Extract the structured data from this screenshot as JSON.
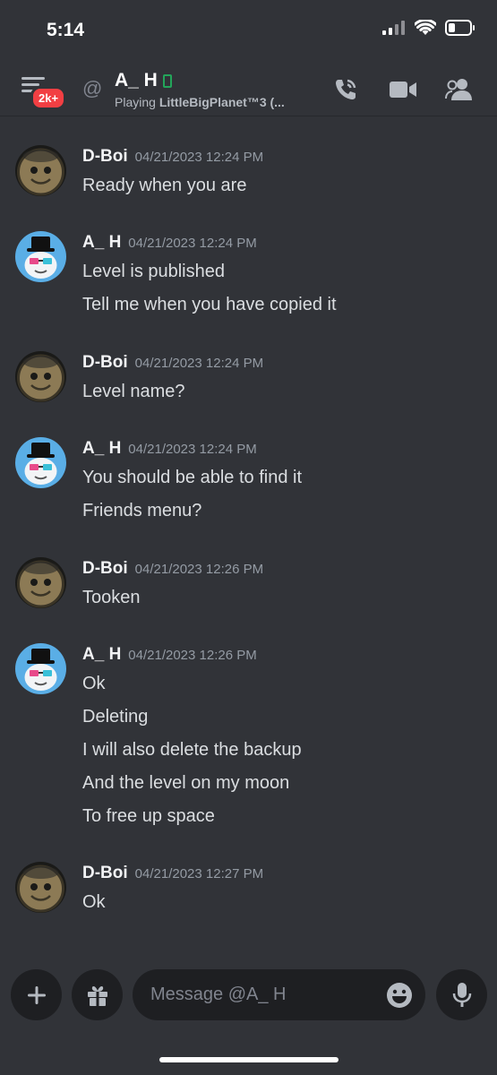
{
  "status_bar": {
    "time": "5:14"
  },
  "header": {
    "badge": "2k+",
    "at_symbol": "@",
    "title": "A_ H",
    "activity_prefix": "Playing ",
    "activity_game": "LittleBigPlanet™3 (..."
  },
  "messages": [
    {
      "author": "D-Boi",
      "timestamp": "04/21/2023 12:24 PM",
      "avatar": "sackboy-avatar",
      "lines": [
        "Ready when you are"
      ]
    },
    {
      "author": "A_ H",
      "timestamp": "04/21/2023 12:24 PM",
      "avatar": "tophat-avatar",
      "lines": [
        "Level is published",
        "Tell me when you have copied it"
      ]
    },
    {
      "author": "D-Boi",
      "timestamp": "04/21/2023 12:24 PM",
      "avatar": "sackboy-avatar",
      "lines": [
        "Level name?"
      ]
    },
    {
      "author": "A_ H",
      "timestamp": "04/21/2023 12:24 PM",
      "avatar": "tophat-avatar",
      "lines": [
        "You should be able to find it",
        "Friends menu?"
      ]
    },
    {
      "author": "D-Boi",
      "timestamp": "04/21/2023 12:26 PM",
      "avatar": "sackboy-avatar",
      "lines": [
        "Tooken"
      ]
    },
    {
      "author": "A_ H",
      "timestamp": "04/21/2023 12:26 PM",
      "avatar": "tophat-avatar",
      "lines": [
        "Ok",
        "Deleting",
        "I will also delete the backup",
        "And the level on my moon",
        "To free up space"
      ]
    },
    {
      "author": "D-Boi",
      "timestamp": "04/21/2023 12:27 PM",
      "avatar": "sackboy-avatar",
      "lines": [
        "Ok"
      ]
    }
  ],
  "composer": {
    "placeholder": "Message @A_ H"
  },
  "colors": {
    "background": "#313338",
    "input_bg": "#1e1f22",
    "badge_red": "#f23f43",
    "online_green": "#23a55a",
    "avatar_blue": "#5aaee6"
  }
}
